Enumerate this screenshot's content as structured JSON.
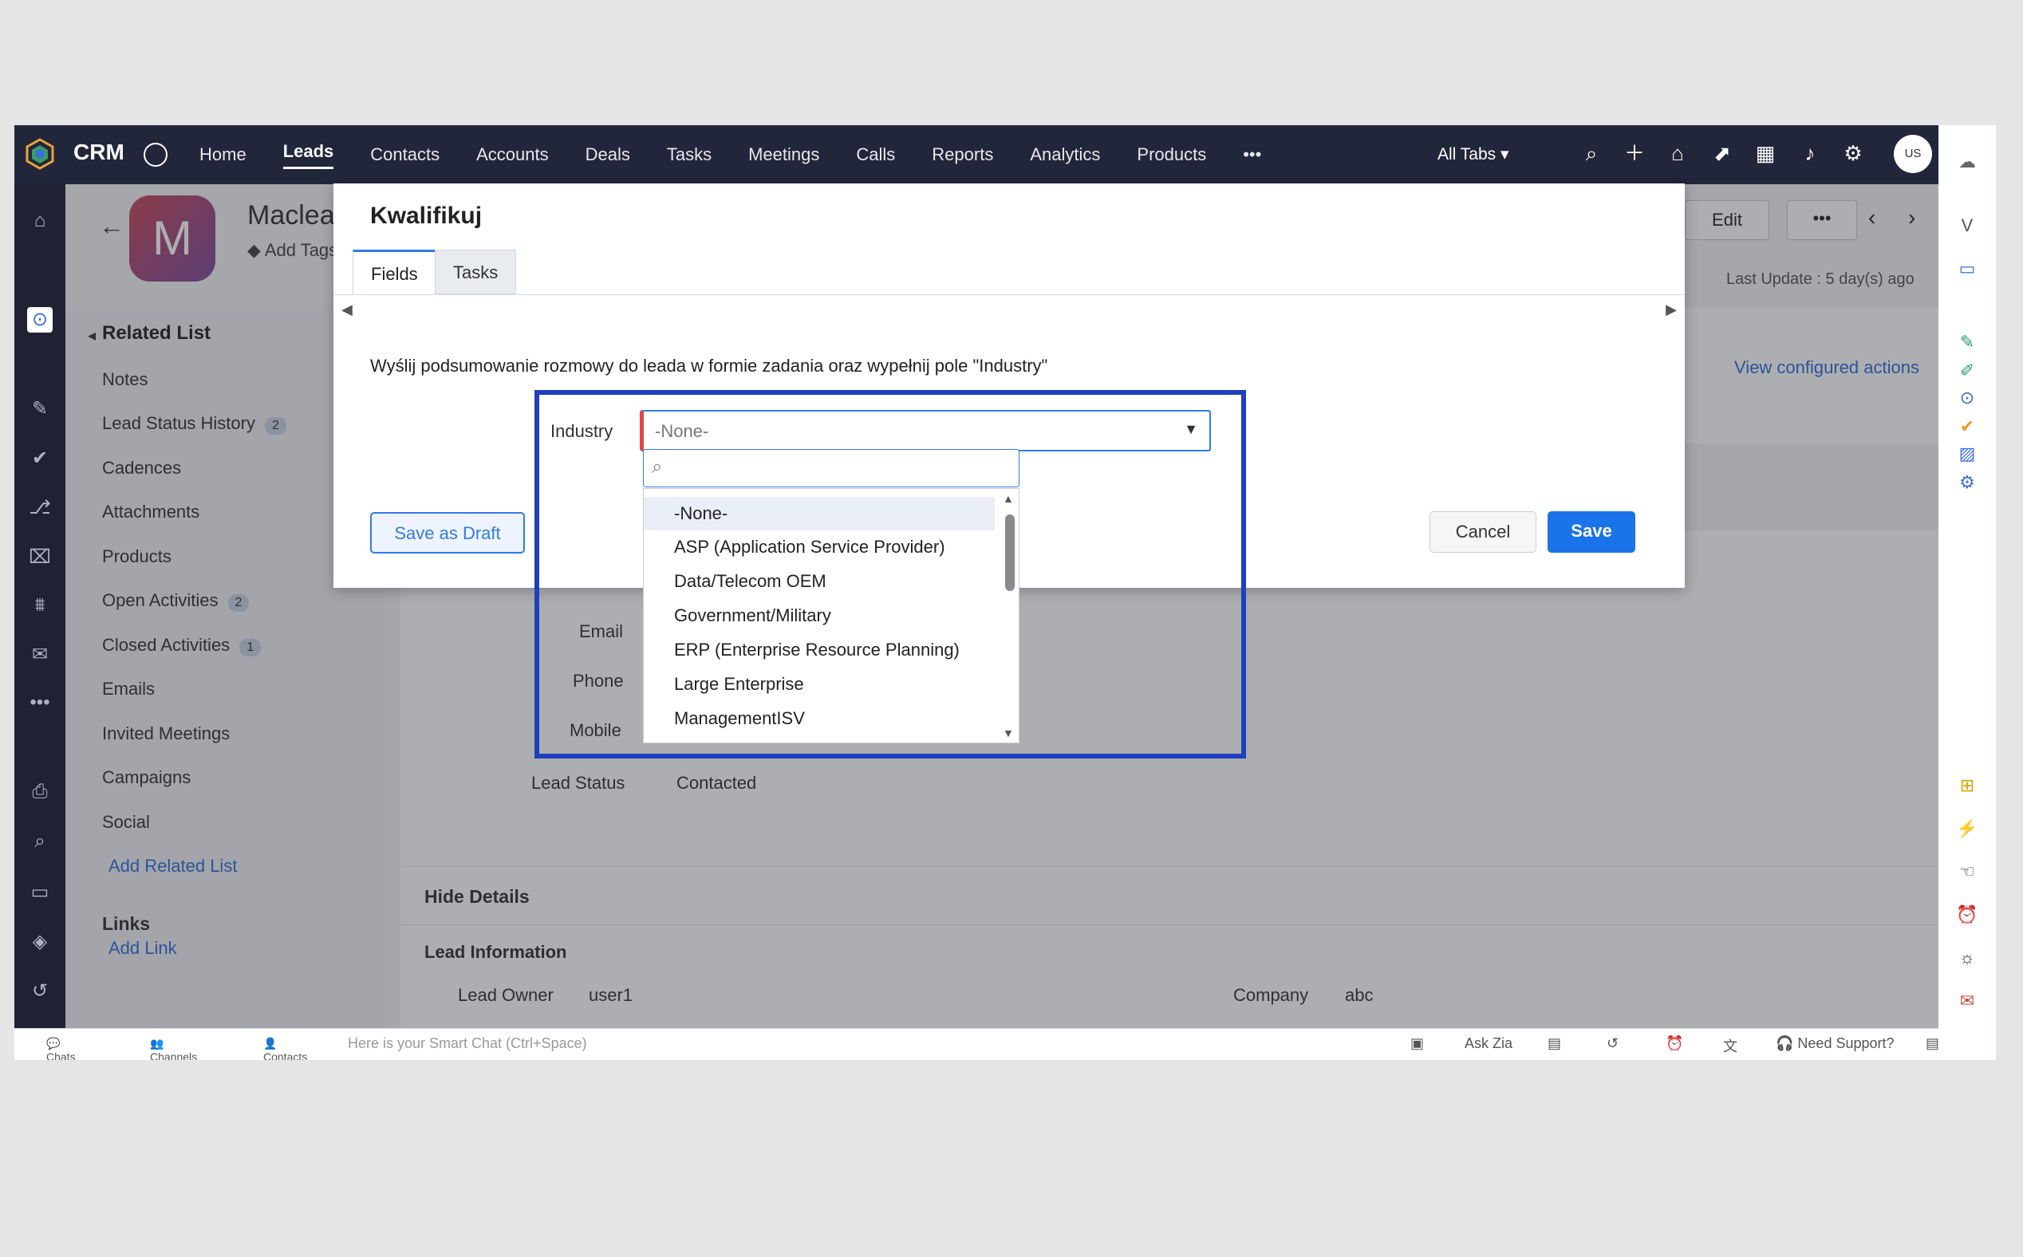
{
  "topbar": {
    "brand": "CRM",
    "nav": [
      "Home",
      "Leads",
      "Contacts",
      "Accounts",
      "Deals",
      "Tasks",
      "Meetings",
      "Calls",
      "Reports",
      "Analytics",
      "Products"
    ],
    "more": "•••",
    "all_tabs": "All Tabs",
    "user_initials": "US"
  },
  "lead": {
    "avatar_letter": "M",
    "name": "Maclead",
    "add_tags": "Add Tags",
    "edit_label": "Edit",
    "more": "•••",
    "last_update": "Last Update : 5 day(s) ago",
    "view_actions": "View configured actions"
  },
  "related_list": {
    "title": "Related List",
    "items": [
      {
        "label": "Notes",
        "count": ""
      },
      {
        "label": "Lead Status History",
        "count": "2"
      },
      {
        "label": "Cadences",
        "count": ""
      },
      {
        "label": "Attachments",
        "count": ""
      },
      {
        "label": "Products",
        "count": ""
      },
      {
        "label": "Open Activities",
        "count": "2"
      },
      {
        "label": "Closed Activities",
        "count": "1"
      },
      {
        "label": "Emails",
        "count": ""
      },
      {
        "label": "Invited Meetings",
        "count": ""
      },
      {
        "label": "Campaigns",
        "count": ""
      },
      {
        "label": "Social",
        "count": ""
      }
    ],
    "add_related": "Add Related List",
    "links_title": "Links",
    "add_link": "Add Link"
  },
  "background_fields": {
    "email": "Email",
    "phone": "Phone",
    "mobile": "Mobile",
    "lead_status_label": "Lead Status",
    "lead_status_value": "Contacted",
    "hide_details": "Hide Details",
    "lead_information": "Lead Information",
    "lead_owner_label": "Lead Owner",
    "lead_owner_value": "user1",
    "company_label": "Company",
    "company_value": "abc"
  },
  "modal": {
    "title": "Kwalifikuj",
    "tabs": [
      "Fields",
      "Tasks"
    ],
    "description": "Wyślij podsumowanie rozmowy do leada w formie zadania oraz wypełnij pole \"Industry\"",
    "industry_label": "Industry",
    "industry_value": "-None-",
    "search_value": "",
    "options": [
      "-None-",
      "ASP (Application Service Provider)",
      "Data/Telecom OEM",
      "Government/Military",
      "ERP (Enterprise Resource Planning)",
      "Large Enterprise",
      "ManagementISV"
    ],
    "save_draft": "Save as Draft",
    "cancel": "Cancel",
    "save": "Save"
  },
  "bottombar": {
    "chats": "Chats",
    "channels": "Channels",
    "contacts": "Contacts",
    "smart_chat": "Here is your Smart Chat (Ctrl+Space)",
    "ask_zia": "Ask Zia",
    "need_support": "Need Support?"
  },
  "colors": {
    "topbar": "#22263a",
    "accent": "#1a73e8",
    "highlight": "#1f3fbf",
    "required": "#e04848"
  }
}
